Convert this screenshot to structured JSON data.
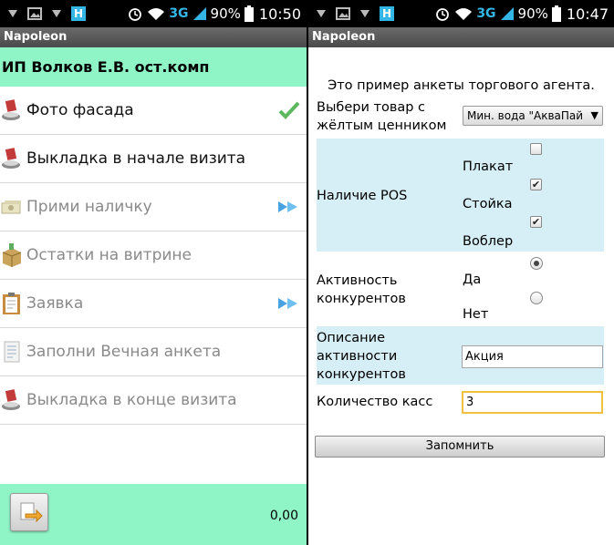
{
  "left": {
    "status_bar": {
      "battery": "90%",
      "network": "3G",
      "time": "10:50"
    },
    "app_title": "Napoleon",
    "client_name": "ИП Волков Е.В. ост.комп",
    "menu": [
      {
        "label": "Фото фасада",
        "icon": "photo-stand-icon",
        "status": "done-check-icon",
        "enabled": true
      },
      {
        "label": "Выкладка в начале визита",
        "icon": "photo-stand-icon",
        "status": "",
        "enabled": true
      },
      {
        "label": "Прими наличку",
        "icon": "cash-icon",
        "status": "forward-arrow-icon",
        "enabled": false
      },
      {
        "label": "Остатки на витрине",
        "icon": "box-icon",
        "status": "",
        "enabled": false
      },
      {
        "label": "Заявка",
        "icon": "clipboard-icon",
        "status": "forward-arrow-icon",
        "enabled": false
      },
      {
        "label": "Заполни Вечная анкета",
        "icon": "form-icon",
        "status": "",
        "enabled": false
      },
      {
        "label": "Выкладка в конце визита",
        "icon": "photo-stand-icon",
        "status": "",
        "enabled": false
      }
    ],
    "footer": {
      "exit_icon": "exit-arrow-icon",
      "total": "0,00"
    }
  },
  "right": {
    "status_bar": {
      "battery": "90%",
      "network": "3G",
      "time": "10:47"
    },
    "app_title": "Napoleon",
    "intro": "Это пример анкеты торгового агента.",
    "product_select": {
      "label_line1": "Выбери товар с",
      "label_line2": "жёлтым ценником",
      "value": "Мин. вода \"АкваПай"
    },
    "pos": {
      "label": "Наличие POS",
      "options": [
        {
          "label": "Плакат",
          "checked": false
        },
        {
          "label": "Стойка",
          "checked": true
        },
        {
          "label": "Воблер",
          "checked": true
        }
      ]
    },
    "competitor_activity": {
      "label_line1": "Активность",
      "label_line2": "конкурентов",
      "options": [
        {
          "label": "Да",
          "selected": true
        },
        {
          "label": "Нет",
          "selected": false
        }
      ]
    },
    "activity_description": {
      "label_line1": "Описание",
      "label_line2": "активности",
      "label_line3": "конкурентов",
      "value": "Акция"
    },
    "registers": {
      "label": "Количество касс",
      "value": "3"
    },
    "save_label": "Запомнить"
  },
  "colors": {
    "accent_green": "#8ff5c7",
    "row_blue": "#d6eef5",
    "status_blue": "#33b5e5",
    "check_green": "#5cb85c"
  }
}
